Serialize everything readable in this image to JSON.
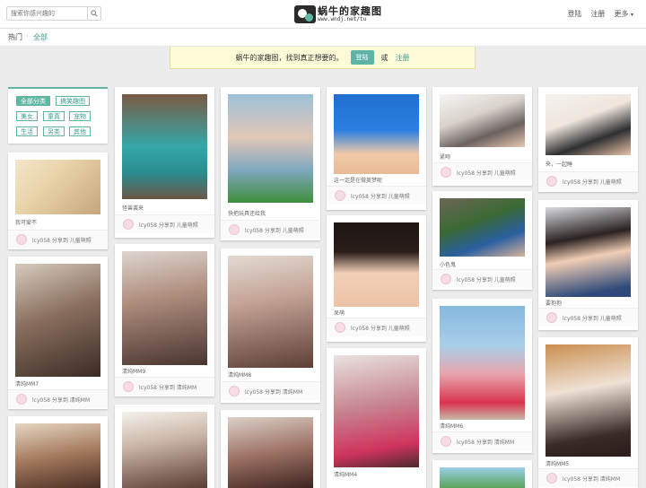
{
  "header": {
    "search_placeholder": "搜索你感兴趣的",
    "logo_title": "蜗牛的家趣图",
    "logo_url": "www.wndj.net/tu",
    "login": "登陆",
    "register": "注册",
    "more": "更多"
  },
  "subnav": {
    "hot": "热门",
    "sep": "·",
    "all": "全部"
  },
  "banner": {
    "text": "蜗牛的家趣图，找到真正想要的。",
    "login": "登陆",
    "or": "或",
    "register": "注册"
  },
  "categories": [
    "全部分类",
    "搞笑趣图",
    "美女",
    "童真",
    "宠物",
    "生活",
    "另类",
    "其他"
  ],
  "colors": {
    "accent": "#5fb7a2",
    "banner_bg": "#fdfbd8"
  },
  "cards": [
    {
      "caption": "我可爱不",
      "by": "lcy058 分享到 儿童萌照"
    },
    {
      "caption": "清纯MM7",
      "by": "lcy058 分享到 清纯MM"
    },
    {
      "caption": "",
      "by": ""
    },
    {
      "caption": "怪兽袭来",
      "by": "lcy058 分享到 儿童萌照"
    },
    {
      "caption": "清纯MM9",
      "by": "lcy058 分享到 清纯MM"
    },
    {
      "caption": "",
      "by": ""
    },
    {
      "caption": "快把玩具还给我",
      "by": "lcy058 分享到 儿童萌照"
    },
    {
      "caption": "清纯MM8",
      "by": "lcy058 分享到 清纯MM"
    },
    {
      "caption": "",
      "by": ""
    },
    {
      "caption": "这一定是在做美梦呢",
      "by": "lcy058 分享到 儿童萌照"
    },
    {
      "caption": "呆萌",
      "by": "lcy058 分享到 儿童萌照"
    },
    {
      "caption": "清纯MM4",
      "by": ""
    },
    {
      "caption": "紧吻",
      "by": "lcy058 分享到 儿童萌照"
    },
    {
      "caption": "小色鬼",
      "by": "lcy058 分享到 儿童萌照"
    },
    {
      "caption": "清纯MM6",
      "by": "lcy058 分享到 清纯MM"
    },
    {
      "caption": "",
      "by": ""
    },
    {
      "caption": "来，一起睡",
      "by": "lcy058 分享到 儿童萌照"
    },
    {
      "caption": "要抱抱",
      "by": "lcy058 分享到 儿童萌照"
    },
    {
      "caption": "清纯MM5",
      "by": "lcy058 分享到 清纯MM"
    }
  ]
}
